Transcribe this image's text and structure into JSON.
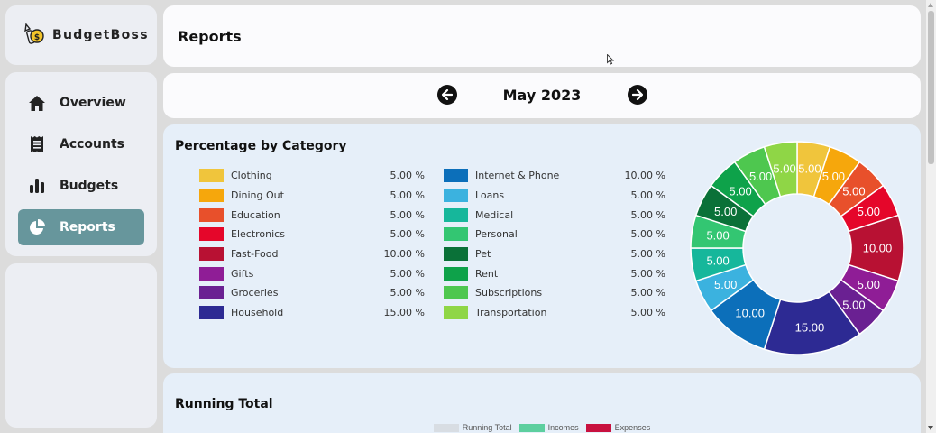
{
  "app": {
    "name": "BudgetBoss"
  },
  "nav": {
    "items": [
      {
        "label": "Overview",
        "icon": "home-icon",
        "active": false
      },
      {
        "label": "Accounts",
        "icon": "receipt-icon",
        "active": false
      },
      {
        "label": "Budgets",
        "icon": "bar-chart-icon",
        "active": false
      },
      {
        "label": "Reports",
        "icon": "pie-chart-icon",
        "active": true
      }
    ]
  },
  "header": {
    "title": "Reports"
  },
  "period": {
    "label": "May 2023",
    "prev_icon": "arrow-left-icon",
    "next_icon": "arrow-right-icon"
  },
  "category_panel": {
    "title": "Percentage by Category"
  },
  "chart_data": {
    "type": "pie",
    "variant": "donut",
    "categories": [
      "Clothing",
      "Dining Out",
      "Education",
      "Electronics",
      "Fast-Food",
      "Gifts",
      "Groceries",
      "Household",
      "Internet & Phone",
      "Loans",
      "Medical",
      "Personal",
      "Pet",
      "Rent",
      "Subscriptions",
      "Transportation"
    ],
    "values": [
      5.0,
      5.0,
      5.0,
      5.0,
      10.0,
      5.0,
      5.0,
      15.0,
      10.0,
      5.0,
      5.0,
      5.0,
      5.0,
      5.0,
      5.0,
      5.0
    ],
    "value_labels": [
      "5.00",
      "5.00",
      "5.00",
      "5.00",
      "10.00",
      "5.00",
      "5.00",
      "15.00",
      "10.00",
      "5.00",
      "5.00",
      "5.00",
      "5.00",
      "5.00",
      "5.00",
      "5.00"
    ],
    "percent_labels": [
      "5.00 %",
      "5.00 %",
      "5.00 %",
      "5.00 %",
      "10.00 %",
      "5.00 %",
      "5.00 %",
      "15.00 %",
      "10.00 %",
      "5.00 %",
      "5.00 %",
      "5.00 %",
      "5.00 %",
      "5.00 %",
      "5.00 %",
      "5.00 %"
    ],
    "colors": [
      "#f0c53c",
      "#f6a70c",
      "#e8502b",
      "#e5062a",
      "#b81133",
      "#8f1d96",
      "#6a2092",
      "#2d2a93",
      "#0c6fba",
      "#3bb2df",
      "#16b79b",
      "#33c672",
      "#0a7138",
      "#0ea24a",
      "#4ec74f",
      "#8fd646"
    ],
    "legend_placement": "left"
  },
  "running_total": {
    "title": "Running Total",
    "legend": [
      {
        "label": "Running Total",
        "color": "#d8dde3"
      },
      {
        "label": "Incomes",
        "color": "#5dcf9f"
      },
      {
        "label": "Expenses",
        "color": "#c8113f"
      }
    ]
  }
}
